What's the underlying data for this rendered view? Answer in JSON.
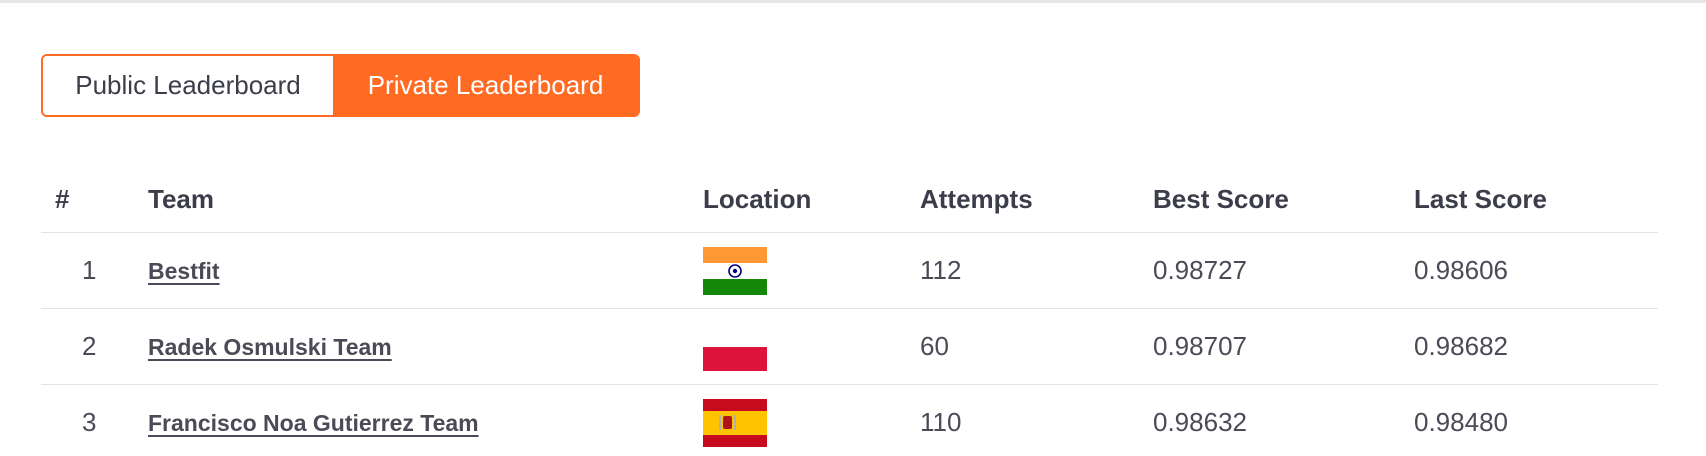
{
  "tabs": {
    "public_label": "Public Leaderboard",
    "private_label": "Private Leaderboard",
    "active": "private",
    "accent_color": "#ff6b22"
  },
  "table": {
    "headers": {
      "rank": "#",
      "team": "Team",
      "location": "Location",
      "attempts": "Attempts",
      "best_score": "Best Score",
      "last_score": "Last Score"
    },
    "rows": [
      {
        "rank": "1",
        "team": "Bestfit",
        "location_flag": "india-flag-icon",
        "attempts": "112",
        "best_score": "0.98727",
        "last_score": "0.98606"
      },
      {
        "rank": "2",
        "team": "Radek Osmulski Team",
        "location_flag": "poland-flag-icon",
        "attempts": "60",
        "best_score": "0.98707",
        "last_score": "0.98682"
      },
      {
        "rank": "3",
        "team": "Francisco Noa Gutierrez Team",
        "location_flag": "spain-flag-icon",
        "attempts": "110",
        "best_score": "0.98632",
        "last_score": "0.98480"
      }
    ]
  }
}
